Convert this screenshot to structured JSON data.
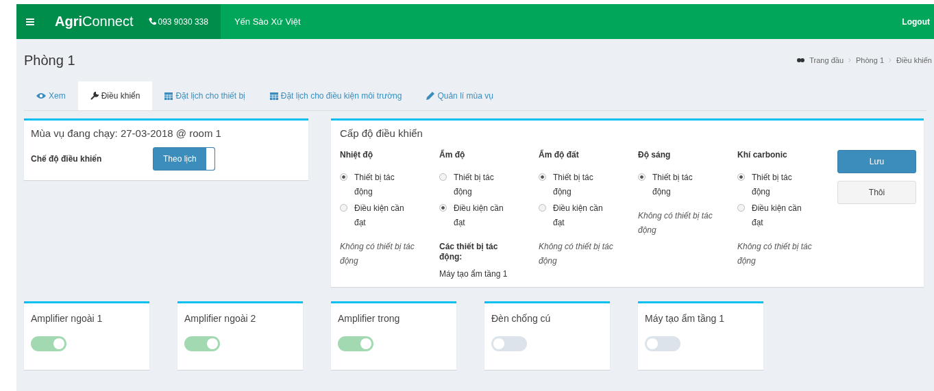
{
  "header": {
    "brand": "**Agri**Connect",
    "phone": "093 9030 338",
    "farm": "Yến Sào Xứ Việt",
    "logout": "Logout"
  },
  "page": {
    "title": "Phòng 1",
    "breadcrumb": [
      "Trang đầu",
      "Phòng 1",
      "Điều khiển"
    ]
  },
  "tabs": [
    {
      "label": "Xem",
      "kind": "eye",
      "selected": false
    },
    {
      "label": "Điều khiển",
      "kind": "wrench",
      "selected": true
    },
    {
      "label": "Đặt lịch cho thiết bị",
      "kind": "calendar",
      "selected": false
    },
    {
      "label": "Đặt lịch cho điều kiện môi trường",
      "kind": "calendar",
      "selected": false
    },
    {
      "label": "Quản lí mùa vụ",
      "kind": "pencil",
      "selected": false
    }
  ],
  "season": {
    "title": "Mùa vụ đang chạy: 27-03-2018 @ room 1",
    "mode_label": "Chế độ điều khiển",
    "mode_toggle": {
      "label": "Theo lịch",
      "on": true
    }
  },
  "control": {
    "title": "Cấp độ điều khiển",
    "columns": [
      {
        "name": "Nhiệt độ",
        "options": [
          {
            "label": "Thiết bị tác động",
            "selected": true
          },
          {
            "label": "Điều kiện cần đạt",
            "selected": false
          }
        ],
        "note": "Không có thiết bị tác động"
      },
      {
        "name": "Ẩm độ",
        "options": [
          {
            "label": "Thiết bị tác động",
            "selected": false
          },
          {
            "label": "Điều kiện cần đạt",
            "selected": true
          }
        ],
        "devices_heading": "Các thiết bị tác động:",
        "devices": [
          "Máy tạo ẩm tầng 1"
        ]
      },
      {
        "name": "Ẩm độ đất",
        "options": [
          {
            "label": "Thiết bị tác động",
            "selected": true
          },
          {
            "label": "Điều kiện cần đạt",
            "selected": false
          }
        ],
        "note": "Không có thiết bị tác động"
      },
      {
        "name": "Độ sáng",
        "options": [
          {
            "label": "Thiết bị tác động",
            "selected": true
          }
        ],
        "note": "Không có thiết bị tác động"
      },
      {
        "name": "Khí carbonic",
        "options": [
          {
            "label": "Thiết bị tác động",
            "selected": true
          },
          {
            "label": "Điều kiện cần đạt",
            "selected": false
          }
        ],
        "note": "Không có thiết bị tác động"
      }
    ],
    "buttons": [
      {
        "label": "Lưu",
        "kind": "primary"
      },
      {
        "label": "Thôi",
        "kind": "default"
      }
    ]
  },
  "devices": [
    {
      "name": "Amplifier ngoài 1",
      "on": true
    },
    {
      "name": "Amplifier ngoài 2",
      "on": true
    },
    {
      "name": "Amplifier trong",
      "on": true
    },
    {
      "name": "Đèn chống cú",
      "on": false
    },
    {
      "name": "Máy tạo ẩm tầng 1",
      "on": false
    }
  ]
}
